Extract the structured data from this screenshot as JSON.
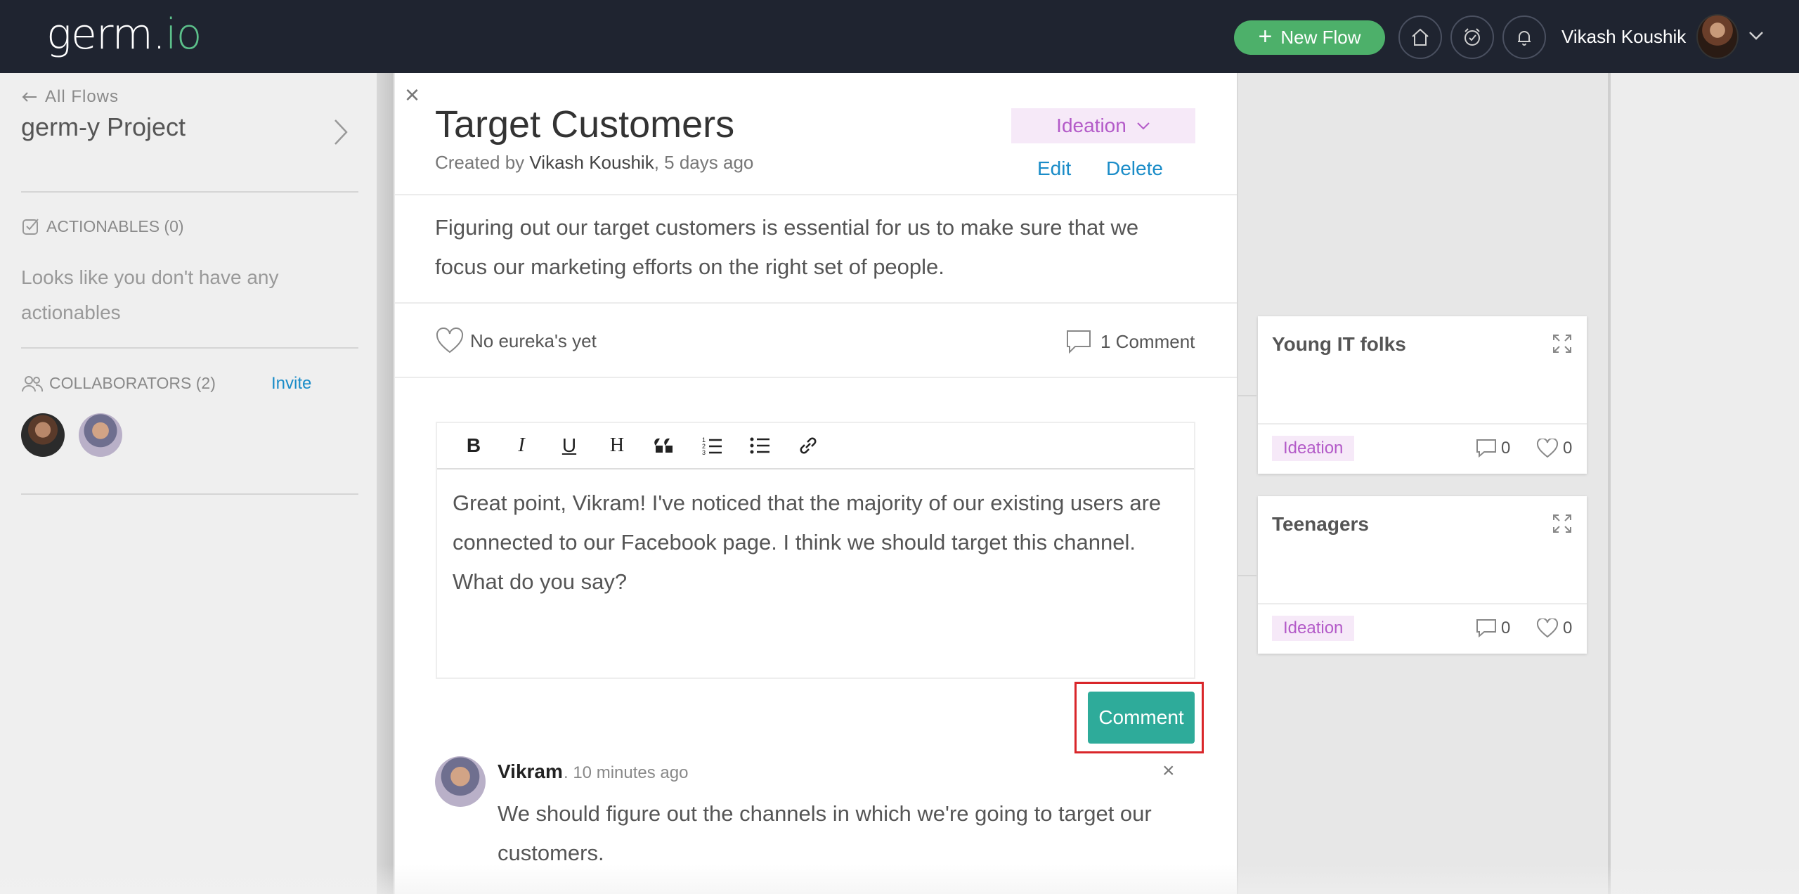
{
  "header": {
    "logo_main": "germ.",
    "logo_accent": "io",
    "new_flow_label": "New Flow",
    "user_name": "Vikash Koushik",
    "icons": [
      "home-icon",
      "alarm-icon",
      "bell-icon",
      "chevron-down-icon"
    ]
  },
  "sidebar": {
    "back_label": "All Flows",
    "project_name": "germ-y Project",
    "actionables_label": "ACTIONABLES (0)",
    "actionables_empty": "Looks like you don't have any actionables",
    "collaborators_label": "COLLABORATORS (2)",
    "invite_label": "Invite"
  },
  "flow": {
    "title": "Target Customers",
    "created_prefix": "Created by",
    "author": "Vikash Koushik",
    "created_suffix": ", 5 days ago",
    "stage": "Ideation",
    "edit_label": "Edit",
    "delete_label": "Delete",
    "description": "Figuring out our target customers is essential for us to make sure that we focus our marketing efforts on the right set of people.",
    "eureka_label": "No eureka's yet",
    "comment_count_label": "1 Comment"
  },
  "editor": {
    "toolbar": [
      "B",
      "I",
      "U",
      "H",
      "quote",
      "ordered-list",
      "bullet-list",
      "link"
    ],
    "text": "Great point, Vikram! I've noticed that the majority of our existing users are connected to our Facebook page. I think we should target this channel. What do you say?",
    "submit_label": "Comment"
  },
  "comments": [
    {
      "author": "Vikram",
      "time": ". 10 minutes ago",
      "text": "We should figure out the channels in which we're going to target our customers."
    }
  ],
  "cards": [
    {
      "title": "Young IT folks",
      "tag": "Ideation",
      "comments": "0",
      "likes": "0"
    },
    {
      "title": "Teenagers",
      "tag": "Ideation",
      "comments": "0",
      "likes": "0"
    }
  ],
  "colors": {
    "topbar": "#1f2430",
    "accent_green": "#4db06a",
    "link_blue": "#1a8cc8",
    "stage_purple": "#b35ac8",
    "comment_teal": "#2eab9a",
    "highlight_red": "#d9262a"
  }
}
